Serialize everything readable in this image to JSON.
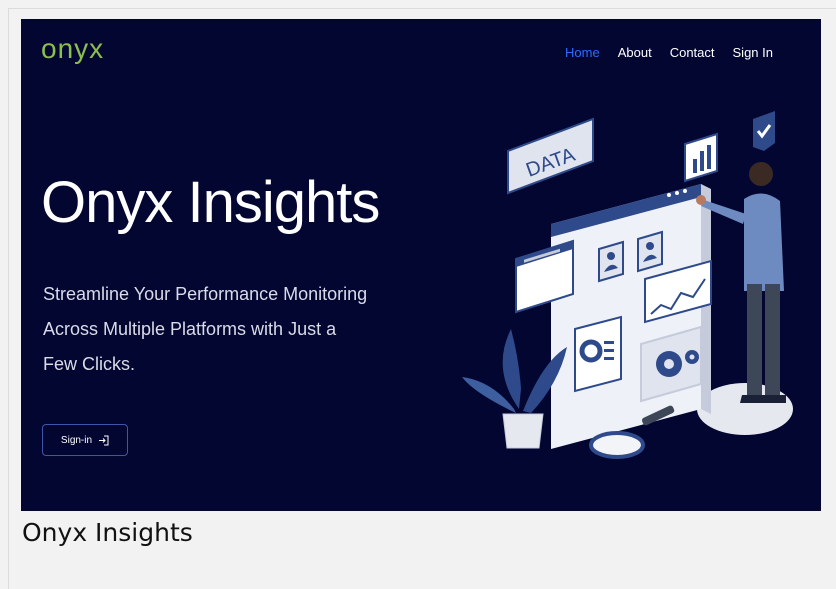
{
  "brand": {
    "logo_text": "onyx",
    "logo_color": "#8cbf4e"
  },
  "nav": {
    "items": [
      "Home",
      "About",
      "Contact",
      "Sign In"
    ],
    "active": "Home"
  },
  "hero": {
    "title": "Onyx Insights",
    "subtitle": "Streamline Your Performance Monitoring Across Multiple Platforms with Just a Few Clicks.",
    "cta_label": "Sign-in",
    "cta_icon": "sign-in-icon"
  },
  "illustration": {
    "board_label": "DATA"
  },
  "caption": "Onyx Insights",
  "colors": {
    "background": "#040632",
    "accent": "#2f6bff",
    "illustration_blue": "#2e4a8b"
  }
}
